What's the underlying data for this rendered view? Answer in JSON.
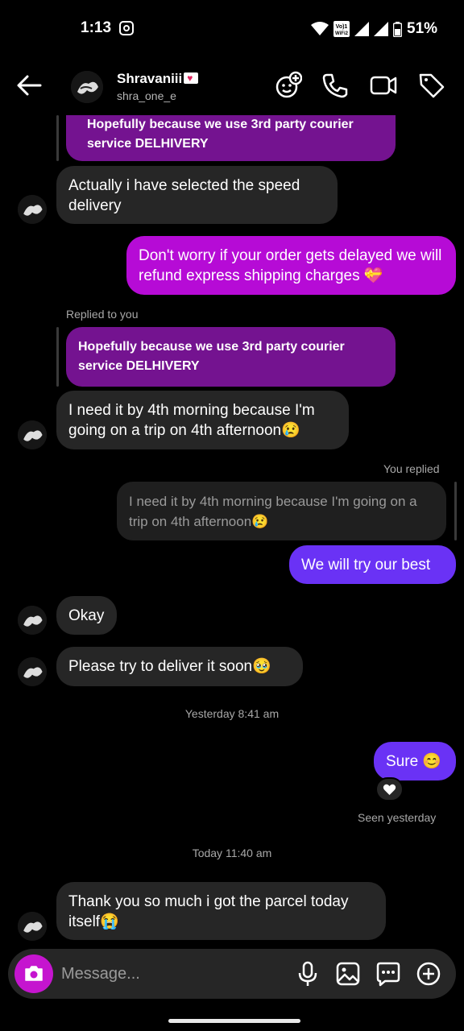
{
  "status_bar": {
    "time": "1:13",
    "battery": "51%",
    "network_label": "Vo) 1 WiFi2"
  },
  "header": {
    "name": "Shravaniii",
    "username": "shra_one_e"
  },
  "messages": {
    "quote1": "Hopefully because we use 3rd party courier service DELHIVERY",
    "m1": "Actually i have selected the speed delivery",
    "m2": "Don't worry if your order gets delayed we will refund express shipping charges 💝",
    "replied_label": "Replied to you",
    "quote2": "Hopefully because we use 3rd party courier service DELHIVERY",
    "m3": "I need it by 4th morning because I'm going on a trip on 4th afternoon😢",
    "you_replied_label": "You replied",
    "quote3": "I need it by 4th morning because I'm going on a trip on 4th afternoon😢",
    "m4": "We will try our best",
    "m5": "Okay",
    "m6": "Please try to deliver it soon🥹",
    "time1": "Yesterday 8:41 am",
    "m7": "Sure 😊",
    "seen": "Seen yesterday",
    "time2": "Today 11:40 am",
    "m8": "Thank you so much i got the parcel today itself😭"
  },
  "composer": {
    "placeholder": "Message..."
  },
  "colors": {
    "sent_pink": "#b60bd6",
    "sent_blue": "#6a32f5",
    "received": "#262626",
    "quote_purple": "#741390",
    "camera": "#c515cf"
  }
}
